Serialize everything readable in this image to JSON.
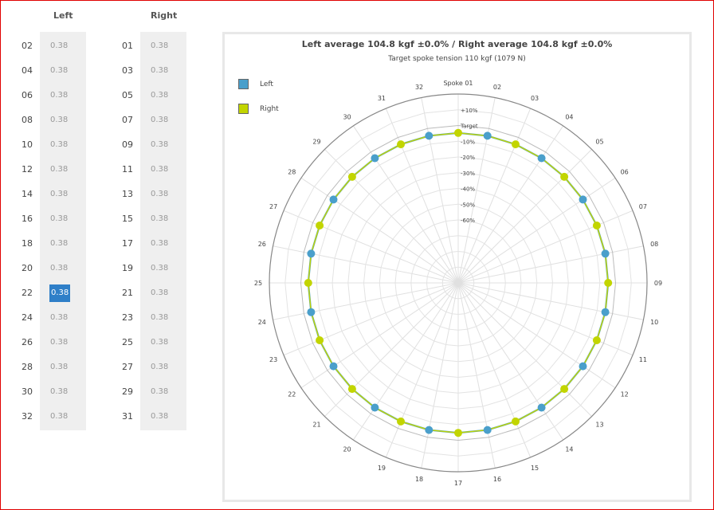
{
  "columns": {
    "left_header": "Left",
    "right_header": "Right"
  },
  "left_spokes": [
    {
      "num": "02",
      "val": "0.38"
    },
    {
      "num": "04",
      "val": "0.38"
    },
    {
      "num": "06",
      "val": "0.38"
    },
    {
      "num": "08",
      "val": "0.38"
    },
    {
      "num": "10",
      "val": "0.38"
    },
    {
      "num": "12",
      "val": "0.38"
    },
    {
      "num": "14",
      "val": "0.38"
    },
    {
      "num": "16",
      "val": "0.38"
    },
    {
      "num": "18",
      "val": "0.38"
    },
    {
      "num": "20",
      "val": "0.38"
    },
    {
      "num": "22",
      "val": "0.38",
      "selected": true
    },
    {
      "num": "24",
      "val": "0.38"
    },
    {
      "num": "26",
      "val": "0.38"
    },
    {
      "num": "28",
      "val": "0.38"
    },
    {
      "num": "30",
      "val": "0.38"
    },
    {
      "num": "32",
      "val": "0.38"
    }
  ],
  "right_spokes": [
    {
      "num": "01",
      "val": "0.38"
    },
    {
      "num": "03",
      "val": "0.38"
    },
    {
      "num": "05",
      "val": "0.38"
    },
    {
      "num": "07",
      "val": "0.38"
    },
    {
      "num": "09",
      "val": "0.38"
    },
    {
      "num": "11",
      "val": "0.38"
    },
    {
      "num": "13",
      "val": "0.38"
    },
    {
      "num": "15",
      "val": "0.38"
    },
    {
      "num": "17",
      "val": "0.38"
    },
    {
      "num": "19",
      "val": "0.38"
    },
    {
      "num": "21",
      "val": "0.38"
    },
    {
      "num": "23",
      "val": "0.38"
    },
    {
      "num": "25",
      "val": "0.38"
    },
    {
      "num": "27",
      "val": "0.38"
    },
    {
      "num": "29",
      "val": "0.38"
    },
    {
      "num": "31",
      "val": "0.38"
    }
  ],
  "chart": {
    "title": "Left average 104.8 kgf ±0.0% / Right average 104.8 kgf ±0.0%",
    "subtitle": "Target spoke tension 110 kgf (1079 N)",
    "legend": [
      {
        "name": "Left",
        "color": "#4a9fcb"
      },
      {
        "name": "Right",
        "color": "#c2d500"
      }
    ]
  },
  "chart_data": {
    "type": "radar",
    "spoke_labels": [
      "Spoke 01",
      "02",
      "03",
      "04",
      "05",
      "06",
      "07",
      "08",
      "09",
      "10",
      "11",
      "12",
      "13",
      "14",
      "15",
      "16",
      "17",
      "18",
      "19",
      "20",
      "21",
      "22",
      "23",
      "24",
      "25",
      "26",
      "27",
      "28",
      "29",
      "30",
      "31",
      "32"
    ],
    "radial_labels": [
      "+10%",
      "Target",
      "-10%",
      "-20%",
      "-30%",
      "-40%",
      "-50%",
      "-60%"
    ],
    "radial_values": [
      10,
      0,
      -10,
      -20,
      -30,
      -40,
      -50,
      -60
    ],
    "rlim": [
      -100,
      20
    ],
    "series": [
      {
        "name": "Left",
        "spokes": [
          2,
          4,
          6,
          8,
          10,
          12,
          14,
          16,
          18,
          20,
          22,
          24,
          26,
          28,
          30,
          32
        ],
        "values": [
          -4.7,
          -4.7,
          -4.7,
          -4.7,
          -4.7,
          -4.7,
          -4.7,
          -4.7,
          -4.7,
          -4.7,
          -4.7,
          -4.7,
          -4.7,
          -4.7,
          -4.7,
          -4.7
        ],
        "color": "#4a9fcb"
      },
      {
        "name": "Right",
        "spokes": [
          1,
          3,
          5,
          7,
          9,
          11,
          13,
          15,
          17,
          19,
          21,
          23,
          25,
          27,
          29,
          31
        ],
        "values": [
          -4.7,
          -4.7,
          -4.7,
          -4.7,
          -4.7,
          -4.7,
          -4.7,
          -4.7,
          -4.7,
          -4.7,
          -4.7,
          -4.7,
          -4.7,
          -4.7,
          -4.7,
          -4.7
        ],
        "color": "#c2d500"
      }
    ]
  }
}
